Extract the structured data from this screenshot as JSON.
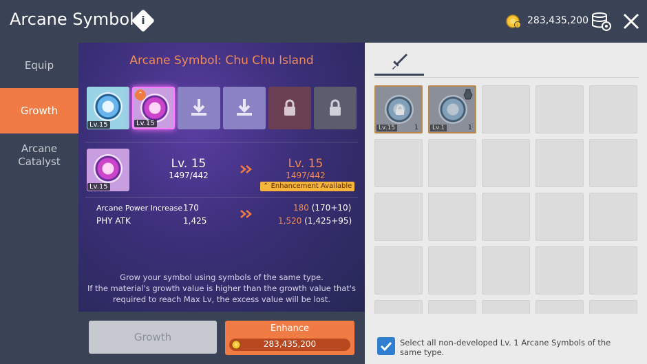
{
  "header": {
    "title": "Arcane Symbol",
    "info_icon": "info-icon",
    "currency_value": "283,435,200",
    "currency_icon": "meso-coin-icon",
    "storage_icon": "storage-icon",
    "close_icon": "close-icon"
  },
  "nav": {
    "items": [
      {
        "label": "Equip",
        "active": false
      },
      {
        "label": "Growth",
        "active": true
      },
      {
        "label": "Arcane\nCatalyst",
        "active": false
      }
    ],
    "active_color": "#f07b45"
  },
  "growth_panel": {
    "title": "Arcane Symbol: Chu Chu Island",
    "slots": [
      {
        "type": "symbol",
        "level": "Lv.15",
        "selected": false
      },
      {
        "type": "symbol",
        "level": "Lv.15",
        "selected": true
      },
      {
        "type": "empty"
      },
      {
        "type": "empty"
      },
      {
        "type": "locked"
      },
      {
        "type": "locked"
      }
    ],
    "selected_symbol_level": "Lv.15",
    "current": {
      "level": "Lv. 15",
      "growth": "1497/442"
    },
    "next": {
      "level": "Lv. 15",
      "growth": "1497/442"
    },
    "enhancement_badge": "Enhancement Available",
    "stats": [
      {
        "label": "Arcane Power Increase",
        "current": "170",
        "next_value": "180",
        "next_detail": "(170+10)"
      },
      {
        "label": "PHY ATK",
        "current": "1,425",
        "next_value": "1,520",
        "next_detail": "(1,425+95)"
      }
    ],
    "description_lines": [
      "Grow your symbol using symbols of the same type.",
      "If the material's growth value is higher than the growth value that's",
      "required to reach Max Lv, the excess value will be lost."
    ],
    "accent_color": "#f28a57"
  },
  "buttons": {
    "growth_label": "Growth",
    "enhance_label": "Enhance",
    "enhance_cost": "283,435,200"
  },
  "inventory": {
    "tab_icon": "weapon-tab-icon",
    "items": [
      {
        "level": "Lv.15",
        "count": "1",
        "locked": true
      },
      {
        "level": "Lv.1",
        "count": "1",
        "locked": false
      }
    ],
    "empty_cells": 23,
    "select_all_checked": true,
    "select_all_label": "Select all non-developed Lv. 1 Arcane Symbols of the same type."
  }
}
